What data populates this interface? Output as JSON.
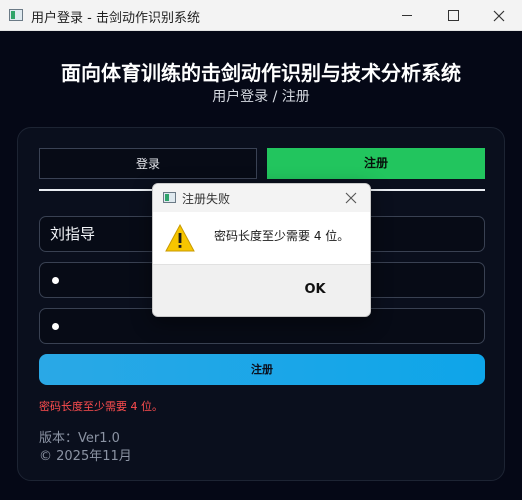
{
  "window": {
    "title": "用户登录 - 击剑动作识别系统",
    "icon": "app-icon"
  },
  "header": {
    "title": "面向体育训练的击剑动作识别与技术分析系统",
    "subtitle": "用户登录 / 注册"
  },
  "tabs": {
    "login": "登录",
    "register": "注册",
    "active": "register"
  },
  "form": {
    "username": "刘指导",
    "password_masked": "●",
    "confirm_masked": "●",
    "submit_label": "注册",
    "error_message": "密码长度至少需要 4 位。"
  },
  "footer": {
    "version": "版本：Ver1.0",
    "copyright": "© 2025年11月"
  },
  "dialog": {
    "title": "注册失败",
    "message": "密码长度至少需要 4 位。",
    "ok_label": "OK",
    "icon": "warning-icon"
  },
  "colors": {
    "background": "#050816",
    "active_tab": "#22c55e",
    "submit_button": "#0ea5e9",
    "error_text": "#ff4d4f"
  }
}
